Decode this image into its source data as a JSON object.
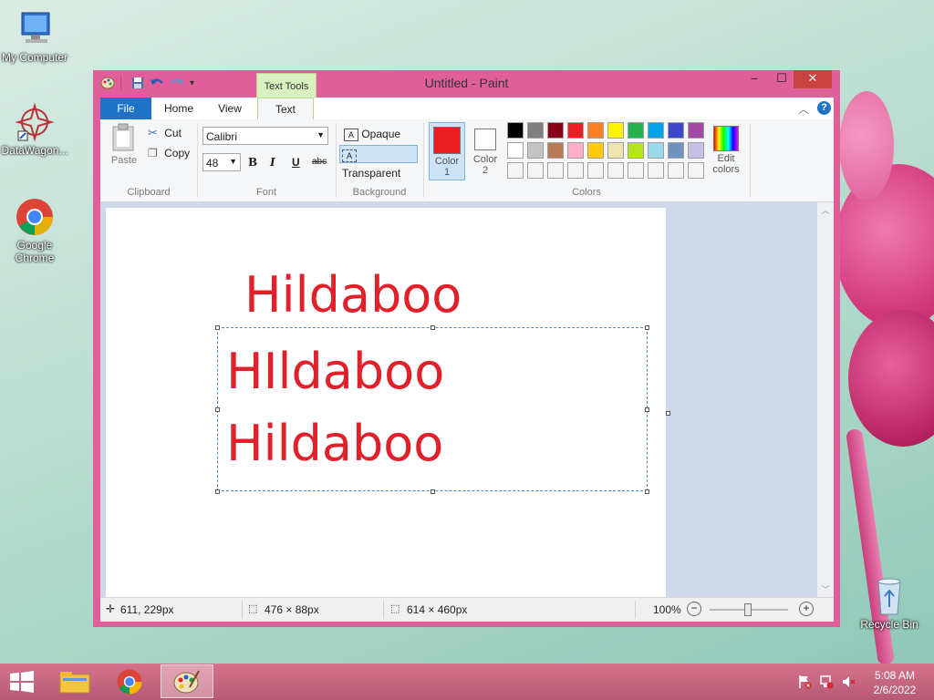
{
  "desktop": {
    "icons": [
      {
        "label": "My Computer"
      },
      {
        "label": "DataWagon..."
      },
      {
        "label": "Google Chrome"
      },
      {
        "label": "Recycle Bin"
      }
    ]
  },
  "window": {
    "title": "Untitled - Paint",
    "contextual_tab_group": "Text Tools",
    "tabs": [
      "File",
      "Home",
      "View",
      "Text"
    ],
    "active_tab": "Text"
  },
  "ribbon": {
    "clipboard": {
      "paste": "Paste",
      "cut": "Cut",
      "copy": "Copy",
      "label": "Clipboard"
    },
    "font": {
      "family": "Calibri",
      "size": "48",
      "label": "Font",
      "bold": "B",
      "italic": "I",
      "underline": "U",
      "strike": "abc"
    },
    "background": {
      "opaque": "Opaque",
      "transparent": "Transparent",
      "label": "Background"
    },
    "colors": {
      "color1_label": "Color",
      "color1_num": "1",
      "color2_label": "Color",
      "color2_num": "2",
      "edit_label_1": "Edit",
      "edit_label_2": "colors",
      "label": "Colors",
      "color1": "#ed1c24",
      "color2": "#ffffff",
      "palette_row1": [
        "#000000",
        "#7f7f7f",
        "#880015",
        "#ed1c24",
        "#ff7f27",
        "#fff200",
        "#22b14c",
        "#00a2e8",
        "#3f48cc",
        "#a349a4"
      ],
      "palette_row2": [
        "#ffffff",
        "#c3c3c3",
        "#b97a57",
        "#ffaec9",
        "#ffc90e",
        "#efe4b0",
        "#b5e61d",
        "#99d9ea",
        "#7092be",
        "#c8bfe7"
      ],
      "palette_row3": [
        "#f4f4f4",
        "#f4f4f4",
        "#f4f4f4",
        "#f4f4f4",
        "#f4f4f4",
        "#f4f4f4",
        "#f4f4f4",
        "#f4f4f4",
        "#f4f4f4",
        "#f4f4f4"
      ]
    }
  },
  "canvas": {
    "texts": [
      "Hildaboo",
      "HIldaboo",
      "Hildaboo"
    ],
    "text_color": "#e0202a"
  },
  "status": {
    "cursor": "611, 229px",
    "selection": "476 × 88px",
    "image_size": "614 × 460px",
    "zoom": "100%",
    "zoom_level": 1.0
  },
  "taskbar": {
    "time": "5:08 AM",
    "date": "2/6/2022"
  }
}
